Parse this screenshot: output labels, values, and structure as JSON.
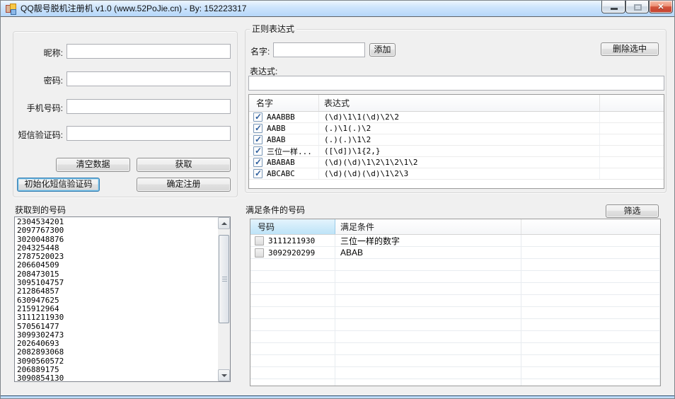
{
  "colors": {
    "titlebar": "#b5d7fa",
    "client_bg": "#f0f0f0",
    "close_button": "#c4402e",
    "sorted_header": "#bde3f7"
  },
  "window": {
    "title": "QQ靓号脱机注册机 v1.0 (www.52PoJie.cn) - By: 152223317"
  },
  "register_form": {
    "fields": [
      {
        "label": "昵称:",
        "value": ""
      },
      {
        "label": "密码:",
        "value": ""
      },
      {
        "label": "手机号码:",
        "value": ""
      },
      {
        "label": "短信验证码:",
        "value": ""
      }
    ],
    "buttons": {
      "clear": "清空数据",
      "fetch": "获取",
      "init_sms": "初始化短信验证码",
      "register": "确定注册"
    }
  },
  "fetched_numbers": {
    "label": "获取到的号码",
    "items": [
      "2304534201",
      "2097767300",
      "3020048876",
      "204325448",
      "2787520023",
      "206604509",
      "208473015",
      "3095104757",
      "212864857",
      "630947625",
      "215912964",
      "3111211930",
      "570561477",
      "3099302473",
      "202640693",
      "2082893068",
      "3090560572",
      "206889175",
      "3090854130"
    ]
  },
  "regex_group": {
    "title": "正则表达式",
    "name_label": "名字:",
    "name_value": "",
    "add_button": "添加",
    "delete_button": "删除选中",
    "expression_label": "表达式:",
    "expression_value": "",
    "table": {
      "headers": [
        "名字",
        "表达式"
      ],
      "rows": [
        {
          "checked": true,
          "name": "AAABBB",
          "expr": "(\\d)\\1\\1(\\d)\\2\\2"
        },
        {
          "checked": true,
          "name": "AABB",
          "expr": "(.)\\1(.)\\2"
        },
        {
          "checked": true,
          "name": "ABAB",
          "expr": "(.)(.)\\1\\2"
        },
        {
          "checked": true,
          "name": "三位一样...",
          "expr": "([\\d])\\1{2,}"
        },
        {
          "checked": true,
          "name": "ABABAB",
          "expr": "(\\d)(\\d)\\1\\2\\1\\2\\1\\2"
        },
        {
          "checked": true,
          "name": "ABCABC",
          "expr": "(\\d)(\\d)(\\d)\\1\\2\\3"
        }
      ]
    }
  },
  "matched_group": {
    "label": "满足条件的号码",
    "filter_button": "筛选",
    "table": {
      "headers": [
        "号码",
        "满足条件"
      ],
      "rows": [
        {
          "checked": false,
          "number": "3111211930",
          "condition": "三位一样的数字"
        },
        {
          "checked": false,
          "number": "3092920299",
          "condition": "ABAB"
        }
      ]
    }
  }
}
